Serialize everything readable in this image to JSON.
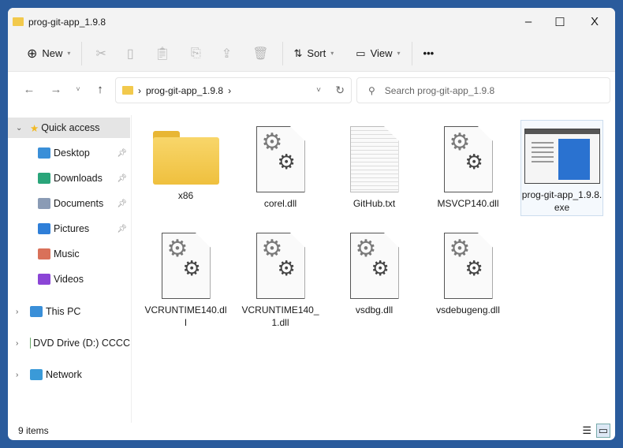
{
  "window": {
    "title": "prog-git-app_1.9.8",
    "minimize": "–",
    "maximize": "☐",
    "close": "X"
  },
  "toolbar": {
    "new": "New",
    "sort": "Sort",
    "view": "View",
    "more": "•••"
  },
  "address": {
    "crumb": "prog-git-app_1.9.8",
    "search_placeholder": "Search prog-git-app_1.9.8"
  },
  "sidebar": {
    "quick_access": "Quick access",
    "items": [
      {
        "label": "Desktop",
        "pinned": true,
        "color": "#3a8fd8"
      },
      {
        "label": "Downloads",
        "pinned": true,
        "color": "#2aa57a"
      },
      {
        "label": "Documents",
        "pinned": true,
        "color": "#8a9bb5"
      },
      {
        "label": "Pictures",
        "pinned": true,
        "color": "#2f7fd8"
      },
      {
        "label": "Music",
        "pinned": false,
        "color": "#d9715a"
      },
      {
        "label": "Videos",
        "pinned": false,
        "color": "#8b45d6"
      }
    ],
    "roots": [
      "This PC",
      "DVD Drive (D:) CCCC",
      "Network"
    ]
  },
  "files": [
    {
      "name": "x86",
      "type": "folder"
    },
    {
      "name": "corel.dll",
      "type": "dll"
    },
    {
      "name": "GitHub.txt",
      "type": "txt"
    },
    {
      "name": "MSVCP140.dll",
      "type": "dll"
    },
    {
      "name": "prog-git-app_1.9.8.exe",
      "type": "exe"
    },
    {
      "name": "VCRUNTIME140.dll",
      "type": "dll"
    },
    {
      "name": "VCRUNTIME140_1.dll",
      "type": "dll"
    },
    {
      "name": "vsdbg.dll",
      "type": "dll"
    },
    {
      "name": "vsdebugeng.dll",
      "type": "dll"
    }
  ],
  "status": {
    "count": "9 items"
  }
}
